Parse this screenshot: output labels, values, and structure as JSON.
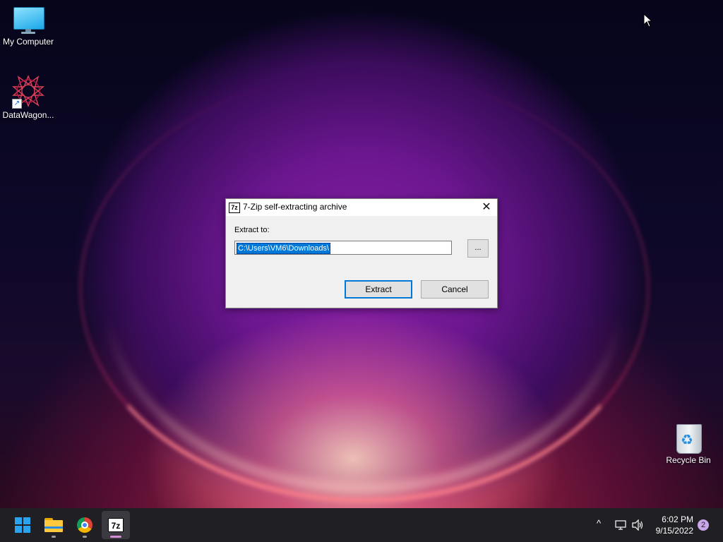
{
  "desktop": {
    "icons": [
      {
        "label": "My Computer",
        "icon": "monitor-icon"
      },
      {
        "label": "DataWagon...",
        "icon": "datawagon-icon"
      },
      {
        "label": "Recycle Bin",
        "icon": "recycle-bin-icon"
      }
    ]
  },
  "dialog": {
    "app_icon_text": "7z",
    "title": "7-Zip self-extracting archive",
    "close_glyph": "✕",
    "extract_label": "Extract to:",
    "path_value": "C:\\Users\\VM6\\Downloads\\",
    "browse_label": "...",
    "extract_button": "Extract",
    "cancel_button": "Cancel",
    "accent": "#0078d7"
  },
  "taskbar": {
    "apps": [
      {
        "name": "Start",
        "icon": "windows-start-icon"
      },
      {
        "name": "File Explorer",
        "icon": "file-explorer-icon"
      },
      {
        "name": "Google Chrome",
        "icon": "chrome-icon"
      },
      {
        "name": "7-Zip",
        "icon": "7zip-icon",
        "text": "7z"
      }
    ],
    "tray": {
      "chevron": "^",
      "time": "6:02 PM",
      "date": "9/15/2022",
      "notification_count": "2"
    }
  }
}
